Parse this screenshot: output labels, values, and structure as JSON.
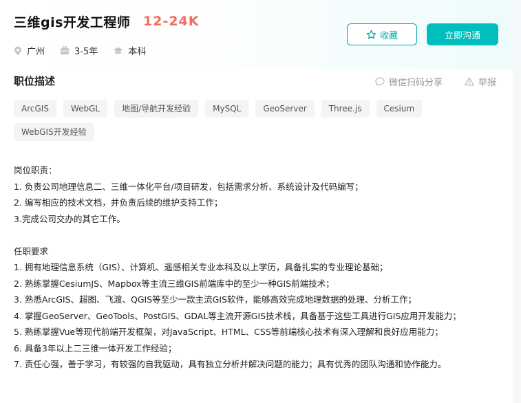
{
  "job": {
    "title": "三维gis开发工程师",
    "salary": "12-24K",
    "city": "广州",
    "experience": "3-5年",
    "education": "本科"
  },
  "actions": {
    "favorite_label": "收藏",
    "chat_label": "立即沟通"
  },
  "section": {
    "title": "职位描述",
    "share_label": "微信扫码分享",
    "report_label": "举报"
  },
  "tags": [
    "ArcGIS",
    "WebGL",
    "地图/导航开发经验",
    "MySQL",
    "GeoServer",
    "Three.js",
    "Cesium",
    "WebGIS开发经验"
  ],
  "description": {
    "duties_heading": "岗位职责：",
    "duties": [
      "1. 负责公司地理信息二、三维一体化平台/项目研发，包括需求分析、系统设计及代码编写；",
      "2. 编写相应的技术文档，并负责后续的维护支持工作；",
      "3.完成公司交办的其它工作。"
    ],
    "requirements_heading": "任职要求",
    "requirements": [
      "1. 拥有地理信息系统（GIS）、计算机、遥感相关专业本科及以上学历，具备扎实的专业理论基础；",
      "2. 熟练掌握CesiumJS、Mapbox等主流三维GIS前端库中的至少一种GIS前端技术；",
      "3. 熟悉ArcGIS、超图、飞渡、QGIS等至少一款主流GIS软件，能够高效完成地理数据的处理、分析工作；",
      "4. 掌握GeoServer、GeoTools、PostGIS、GDAL等主流开源GIS技术栈，具备基于这些工具进行GIS应用开发能力；",
      "5. 熟练掌握Vue等现代前端开发框架，对JavaScript、HTML、CSS等前端核心技术有深入理解和良好应用能力；",
      "6. 具备3年以上二三维一体开发工作经验；",
      "7. 责任心强，善于学习，有较强的自我驱动，具有独立分析并解决问题的能力；具有优秀的团队沟通和协作能力。"
    ]
  },
  "colors": {
    "accent": "#00bebd",
    "salary": "#f26d5b"
  }
}
